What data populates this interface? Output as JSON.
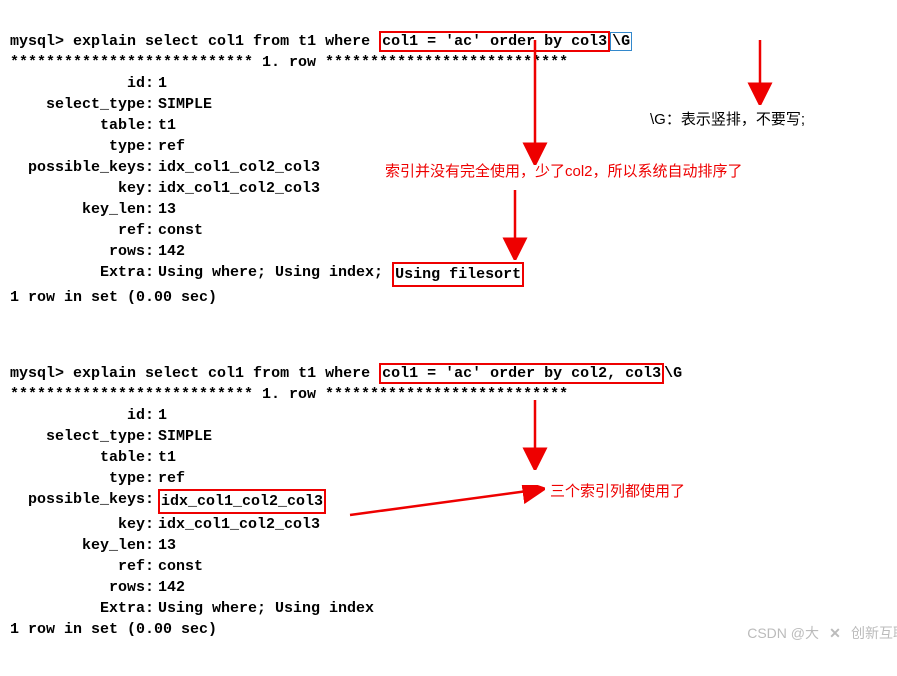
{
  "query1": {
    "prompt": "mysql>",
    "cmd_prefix": "explain select col1 from t1 where ",
    "cmd_boxed": "col1 = 'ac' order by col3",
    "cmd_suffix_boxed": "\\G",
    "row_sep": "*************************** 1. row ***************************",
    "fields": {
      "id": "1",
      "select_type": "SIMPLE",
      "table": "t1",
      "type": "ref",
      "possible_keys": "idx_col1_col2_col3",
      "key": "idx_col1_col2_col3",
      "key_len": "13",
      "ref": "const",
      "rows": "142"
    },
    "extra_label": "Extra",
    "extra_prefix": "Using where; Using index; ",
    "extra_boxed": "Using filesort",
    "footer": "1 row in set (0.00 sec)"
  },
  "query2": {
    "prompt": "mysql>",
    "cmd_prefix": "explain select col1 from t1 where ",
    "cmd_boxed": "col1 = 'ac' order by col2, col3",
    "cmd_suffix": "\\G",
    "row_sep": "*************************** 1. row ***************************",
    "fields": {
      "id": "1",
      "select_type": "SIMPLE",
      "table": "t1",
      "type": "ref",
      "key": "idx_col1_col2_col3",
      "key_len": "13",
      "ref": "const",
      "rows": "142"
    },
    "pk_label": "possible_keys",
    "pk_boxed": "idx_col1_col2_col3",
    "extra_label": "Extra",
    "extra_val": "Using where; Using index",
    "footer": "1 row in set (0.00 sec)"
  },
  "annotations": {
    "g_note": "\\G：表示竖排，不要写;",
    "index_note": "索引并没有完全使用，少了col2，所以系统自动排序了",
    "all_used": "三个索引列都使用了"
  },
  "watermark": {
    "text1": "CSDN @大",
    "text2": "创新互联"
  }
}
